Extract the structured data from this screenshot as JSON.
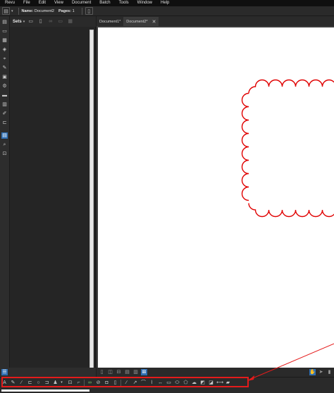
{
  "menubar": {
    "items": [
      "Revu",
      "File",
      "Edit",
      "View",
      "Document",
      "Batch",
      "Tools",
      "Window",
      "Help"
    ]
  },
  "toolbar": {
    "name_label": "Name:",
    "name_value": "Document2",
    "pages_label": "Pages:",
    "pages_value": "1"
  },
  "panel": {
    "title": "Sets"
  },
  "tabs": [
    {
      "label": "Document1*"
    },
    {
      "label": "Document2*",
      "close": "✕"
    }
  ],
  "annotation_colors": {
    "cloud": "#e00000",
    "highlight_box": "#e51b1b",
    "accent": "#2f6fb3"
  }
}
